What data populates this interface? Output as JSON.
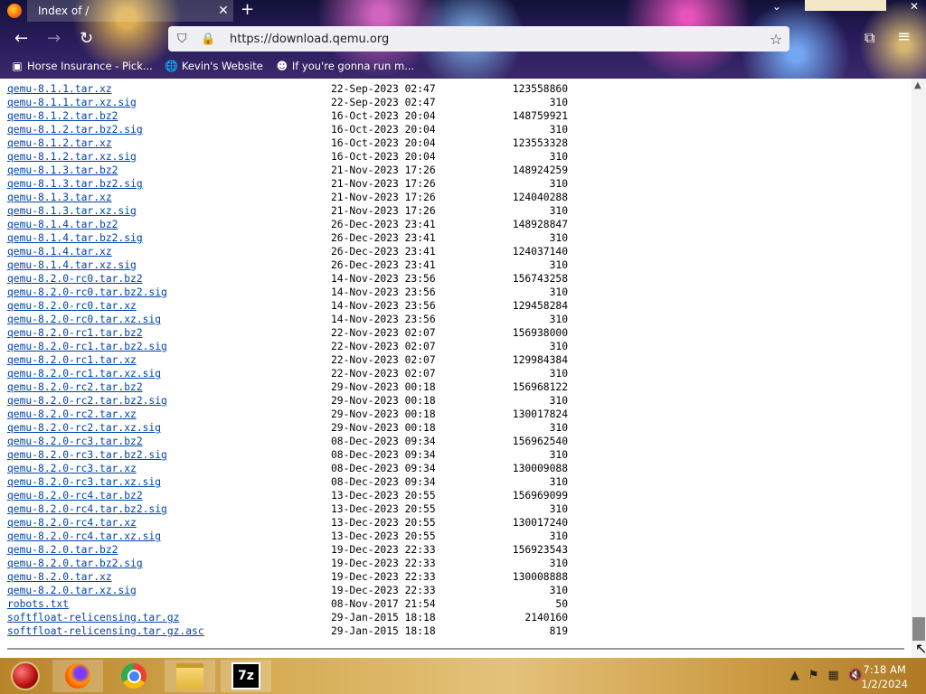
{
  "browser": {
    "tab_title": "Index of /",
    "url": "https://download.qemu.org",
    "bookmarks": [
      {
        "label": "Horse Insurance - Pick...",
        "icon": "horse-icon"
      },
      {
        "label": "Kevin's Website",
        "icon": "globe-icon"
      },
      {
        "label": "If you're gonna run m...",
        "icon": "mask-icon"
      }
    ]
  },
  "files": [
    {
      "name": "qemu-8.1.1.tar.xz",
      "date": "22-Sep-2023 02:47",
      "size": "123558860"
    },
    {
      "name": "qemu-8.1.1.tar.xz.sig",
      "date": "22-Sep-2023 02:47",
      "size": "310"
    },
    {
      "name": "qemu-8.1.2.tar.bz2",
      "date": "16-Oct-2023 20:04",
      "size": "148759921"
    },
    {
      "name": "qemu-8.1.2.tar.bz2.sig",
      "date": "16-Oct-2023 20:04",
      "size": "310"
    },
    {
      "name": "qemu-8.1.2.tar.xz",
      "date": "16-Oct-2023 20:04",
      "size": "123553328"
    },
    {
      "name": "qemu-8.1.2.tar.xz.sig",
      "date": "16-Oct-2023 20:04",
      "size": "310"
    },
    {
      "name": "qemu-8.1.3.tar.bz2",
      "date": "21-Nov-2023 17:26",
      "size": "148924259"
    },
    {
      "name": "qemu-8.1.3.tar.bz2.sig",
      "date": "21-Nov-2023 17:26",
      "size": "310"
    },
    {
      "name": "qemu-8.1.3.tar.xz",
      "date": "21-Nov-2023 17:26",
      "size": "124040288"
    },
    {
      "name": "qemu-8.1.3.tar.xz.sig",
      "date": "21-Nov-2023 17:26",
      "size": "310"
    },
    {
      "name": "qemu-8.1.4.tar.bz2",
      "date": "26-Dec-2023 23:41",
      "size": "148928847"
    },
    {
      "name": "qemu-8.1.4.tar.bz2.sig",
      "date": "26-Dec-2023 23:41",
      "size": "310"
    },
    {
      "name": "qemu-8.1.4.tar.xz",
      "date": "26-Dec-2023 23:41",
      "size": "124037140"
    },
    {
      "name": "qemu-8.1.4.tar.xz.sig",
      "date": "26-Dec-2023 23:41",
      "size": "310"
    },
    {
      "name": "qemu-8.2.0-rc0.tar.bz2",
      "date": "14-Nov-2023 23:56",
      "size": "156743258"
    },
    {
      "name": "qemu-8.2.0-rc0.tar.bz2.sig",
      "date": "14-Nov-2023 23:56",
      "size": "310"
    },
    {
      "name": "qemu-8.2.0-rc0.tar.xz",
      "date": "14-Nov-2023 23:56",
      "size": "129458284"
    },
    {
      "name": "qemu-8.2.0-rc0.tar.xz.sig",
      "date": "14-Nov-2023 23:56",
      "size": "310"
    },
    {
      "name": "qemu-8.2.0-rc1.tar.bz2",
      "date": "22-Nov-2023 02:07",
      "size": "156938000"
    },
    {
      "name": "qemu-8.2.0-rc1.tar.bz2.sig",
      "date": "22-Nov-2023 02:07",
      "size": "310"
    },
    {
      "name": "qemu-8.2.0-rc1.tar.xz",
      "date": "22-Nov-2023 02:07",
      "size": "129984384"
    },
    {
      "name": "qemu-8.2.0-rc1.tar.xz.sig",
      "date": "22-Nov-2023 02:07",
      "size": "310"
    },
    {
      "name": "qemu-8.2.0-rc2.tar.bz2",
      "date": "29-Nov-2023 00:18",
      "size": "156968122"
    },
    {
      "name": "qemu-8.2.0-rc2.tar.bz2.sig",
      "date": "29-Nov-2023 00:18",
      "size": "310"
    },
    {
      "name": "qemu-8.2.0-rc2.tar.xz",
      "date": "29-Nov-2023 00:18",
      "size": "130017824"
    },
    {
      "name": "qemu-8.2.0-rc2.tar.xz.sig",
      "date": "29-Nov-2023 00:18",
      "size": "310"
    },
    {
      "name": "qemu-8.2.0-rc3.tar.bz2",
      "date": "08-Dec-2023 09:34",
      "size": "156962540"
    },
    {
      "name": "qemu-8.2.0-rc3.tar.bz2.sig",
      "date": "08-Dec-2023 09:34",
      "size": "310"
    },
    {
      "name": "qemu-8.2.0-rc3.tar.xz",
      "date": "08-Dec-2023 09:34",
      "size": "130009088"
    },
    {
      "name": "qemu-8.2.0-rc3.tar.xz.sig",
      "date": "08-Dec-2023 09:34",
      "size": "310"
    },
    {
      "name": "qemu-8.2.0-rc4.tar.bz2",
      "date": "13-Dec-2023 20:55",
      "size": "156969099"
    },
    {
      "name": "qemu-8.2.0-rc4.tar.bz2.sig",
      "date": "13-Dec-2023 20:55",
      "size": "310"
    },
    {
      "name": "qemu-8.2.0-rc4.tar.xz",
      "date": "13-Dec-2023 20:55",
      "size": "130017240"
    },
    {
      "name": "qemu-8.2.0-rc4.tar.xz.sig",
      "date": "13-Dec-2023 20:55",
      "size": "310"
    },
    {
      "name": "qemu-8.2.0.tar.bz2",
      "date": "19-Dec-2023 22:33",
      "size": "156923543"
    },
    {
      "name": "qemu-8.2.0.tar.bz2.sig",
      "date": "19-Dec-2023 22:33",
      "size": "310"
    },
    {
      "name": "qemu-8.2.0.tar.xz",
      "date": "19-Dec-2023 22:33",
      "size": "130008888"
    },
    {
      "name": "qemu-8.2.0.tar.xz.sig",
      "date": "19-Dec-2023 22:33",
      "size": "310"
    },
    {
      "name": "robots.txt",
      "date": "08-Nov-2017 21:54",
      "size": "50"
    },
    {
      "name": "softfloat-relicensing.tar.gz",
      "date": "29-Jan-2015 18:18",
      "size": "2140160"
    },
    {
      "name": "softfloat-relicensing.tar.gz.asc",
      "date": "29-Jan-2015 18:18",
      "size": "819"
    }
  ],
  "taskbar": {
    "apps": [
      "ornament-start-icon",
      "firefox-icon",
      "chrome-icon",
      "file-explorer-icon",
      "7zip-icon"
    ],
    "sevenzip_label": "7z",
    "time": "7:18 AM",
    "date": "1/2/2024"
  }
}
